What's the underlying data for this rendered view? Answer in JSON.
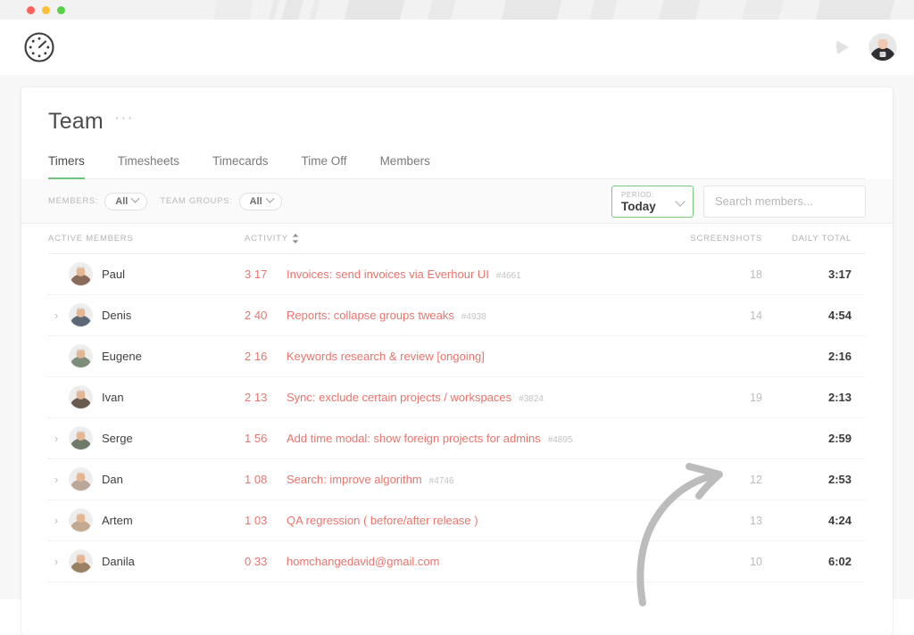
{
  "window": {
    "traffic_lights": [
      "close",
      "minimize",
      "maximize"
    ]
  },
  "appbar": {
    "logo_icon": "everhour-timer-logo-icon",
    "play_icon": "play-timer-icon",
    "avatar_icon": "user-avatar"
  },
  "header": {
    "title": "Team",
    "more_menu": "···"
  },
  "tabs": [
    {
      "label": "Timers",
      "active": true
    },
    {
      "label": "Timesheets",
      "active": false
    },
    {
      "label": "Timecards",
      "active": false
    },
    {
      "label": "Time Off",
      "active": false
    },
    {
      "label": "Members",
      "active": false
    }
  ],
  "filters": {
    "members_label": "MEMBERS:",
    "members_value": "All",
    "team_groups_label": "TEAM GROUPS:",
    "team_groups_value": "All",
    "period_label": "PERIOD:",
    "period_value": "Today",
    "search_placeholder": "Search members...",
    "search_value": ""
  },
  "table": {
    "headers": {
      "members": "ACTIVE MEMBERS",
      "activity": "ACTIVITY",
      "screenshots": "SCREENSHOTS",
      "daily_total": "DAILY TOTAL"
    },
    "sort_icon": "sort-updown-icon",
    "rows": [
      {
        "expandable": false,
        "name": "Paul",
        "timer": "3 17",
        "task": "Invoices: send invoices via Everhour UI",
        "task_id": "#4661",
        "screenshots": "18",
        "daily_total": "3:17",
        "avatar_tone": "#8a6a58"
      },
      {
        "expandable": true,
        "name": "Denis",
        "timer": "2 40",
        "task": "Reports: collapse groups tweaks",
        "task_id": "#4938",
        "screenshots": "14",
        "daily_total": "4:54",
        "avatar_tone": "#5d6876"
      },
      {
        "expandable": false,
        "name": "Eugene",
        "timer": "2 16",
        "task": "Keywords research & review [ongoing]",
        "task_id": "",
        "screenshots": "",
        "daily_total": "2:16",
        "avatar_tone": "#7e8c7a"
      },
      {
        "expandable": false,
        "name": "Ivan",
        "timer": "2 13",
        "task": "Sync: exclude certain projects / workspaces",
        "task_id": "#3824",
        "screenshots": "19",
        "daily_total": "2:13",
        "avatar_tone": "#6b5a4e"
      },
      {
        "expandable": true,
        "name": "Serge",
        "timer": "1 56",
        "task": "Add time modal: show foreign projects for admins",
        "task_id": "#4895",
        "screenshots": "",
        "daily_total": "2:59",
        "avatar_tone": "#707a6a"
      },
      {
        "expandable": true,
        "name": "Dan",
        "timer": "1 08",
        "task": "Search: improve algorithm",
        "task_id": "#4746",
        "screenshots": "12",
        "daily_total": "2:53",
        "avatar_tone": "#b9a79a"
      },
      {
        "expandable": true,
        "name": "Artem",
        "timer": "1 03",
        "task": "QA regression ( before/after release )",
        "task_id": "",
        "screenshots": "13",
        "daily_total": "4:24",
        "avatar_tone": "#c2a98f"
      },
      {
        "expandable": true,
        "name": "Danila",
        "timer": "0 33",
        "task": "homchangedavid@gmail.com",
        "task_id": "",
        "screenshots": "10",
        "daily_total": "6:02",
        "avatar_tone": "#9a7f63"
      }
    ]
  },
  "annotation": {
    "arrow_icon": "curved-arrow-annotation",
    "arrow_color": "#bcbcbc",
    "points_to": "SCREENSHOTS"
  },
  "colors": {
    "accent_green": "#6ec478",
    "task_red": "#e8756d",
    "muted_gray": "#b3b3b3",
    "text_dark": "#3f3f3f"
  }
}
